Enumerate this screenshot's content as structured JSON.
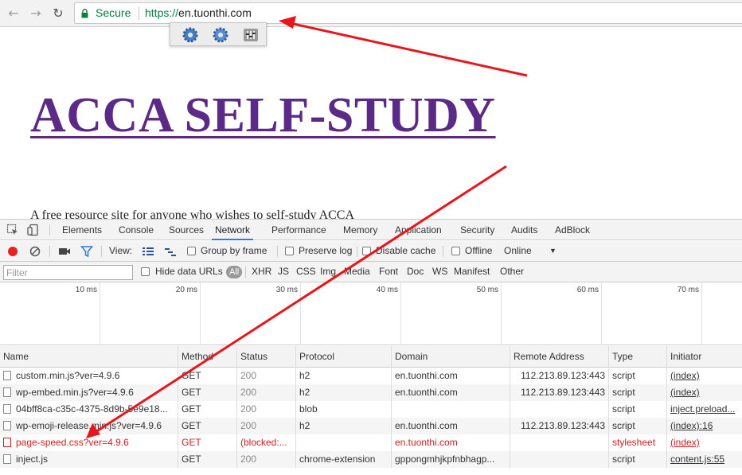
{
  "browser": {
    "secure_label": "Secure",
    "url_scheme": "https://",
    "url_host": "en.tuonthi.com"
  },
  "page": {
    "title": "ACCA SELF-STUDY",
    "tagline": "A free resource site for anyone who wishes to self-study ACCA"
  },
  "devtools": {
    "tabs": [
      "Elements",
      "Console",
      "Sources",
      "Network",
      "Performance",
      "Memory",
      "Application",
      "Security",
      "Audits",
      "AdBlock"
    ],
    "active_tab": "Network",
    "view_label": "View:",
    "group_by_frame": "Group by frame",
    "preserve_log": "Preserve log",
    "disable_cache": "Disable cache",
    "offline": "Offline",
    "throttle": "Online",
    "filter_placeholder": "Filter",
    "hide_data_urls": "Hide data URLs",
    "type_all": "All",
    "types": [
      "XHR",
      "JS",
      "CSS",
      "Img",
      "Media",
      "Font",
      "Doc",
      "WS",
      "Manifest",
      "Other"
    ],
    "timeline_ticks": [
      "10 ms",
      "20 ms",
      "30 ms",
      "40 ms",
      "50 ms",
      "60 ms",
      "70 ms"
    ],
    "columns": [
      "Name",
      "Method",
      "Status",
      "Protocol",
      "Domain",
      "Remote Address",
      "Type",
      "Initiator"
    ],
    "rows": [
      {
        "name": "custom.min.js?ver=4.9.6",
        "method": "GET",
        "status": "200",
        "protocol": "h2",
        "domain": "en.tuonthi.com",
        "remote": "112.213.89.123:443",
        "type": "script",
        "initiator": "(index)",
        "error": false
      },
      {
        "name": "wp-embed.min.js?ver=4.9.6",
        "method": "GET",
        "status": "200",
        "protocol": "h2",
        "domain": "en.tuonthi.com",
        "remote": "112.213.89.123:443",
        "type": "script",
        "initiator": "(index)",
        "error": false
      },
      {
        "name": "04bff8ca-c35c-4375-8d9b-5e9e18...",
        "method": "GET",
        "status": "200",
        "protocol": "blob",
        "domain": "",
        "remote": "",
        "type": "script",
        "initiator": "inject.preload...",
        "error": false
      },
      {
        "name": "wp-emoji-release.min.js?ver=4.9.6",
        "method": "GET",
        "status": "200",
        "protocol": "h2",
        "domain": "en.tuonthi.com",
        "remote": "112.213.89.123:443",
        "type": "script",
        "initiator": "(index):16",
        "error": false
      },
      {
        "name": "page-speed.css?ver=4.9.6",
        "method": "GET",
        "status": "(blocked:...",
        "protocol": "",
        "domain": "en.tuonthi.com",
        "remote": "",
        "type": "stylesheet",
        "initiator": "(index)",
        "error": true
      },
      {
        "name": "inject.js",
        "method": "GET",
        "status": "200",
        "protocol": "chrome-extension",
        "domain": "gppongmhjkpfnbhagp...",
        "remote": "",
        "type": "script",
        "initiator": "content.js:55",
        "error": false
      }
    ]
  },
  "colors": {
    "title": "#5b2a86",
    "secure": "#0b8043",
    "error": "#d21f1f",
    "annotation_arrow": "#e8161b",
    "active_tab_border": "#3879d9"
  }
}
